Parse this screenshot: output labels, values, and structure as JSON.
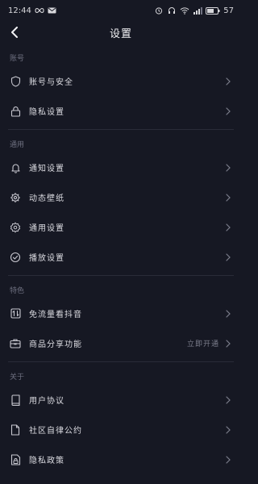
{
  "status_bar": {
    "time": "12:44",
    "battery": "57"
  },
  "nav": {
    "title": "设置"
  },
  "sections": [
    {
      "header": "账号",
      "items": [
        {
          "label": "账号与安全",
          "icon": "shield-icon"
        },
        {
          "label": "隐私设置",
          "icon": "lock-icon"
        }
      ]
    },
    {
      "header": "通用",
      "items": [
        {
          "label": "通知设置",
          "icon": "bell-icon"
        },
        {
          "label": "动态壁纸",
          "icon": "wallpaper-icon"
        },
        {
          "label": "通用设置",
          "icon": "gear-icon"
        },
        {
          "label": "播放设置",
          "icon": "play-icon"
        }
      ]
    },
    {
      "header": "特色",
      "items": [
        {
          "label": "免流量看抖音",
          "icon": "data-icon"
        },
        {
          "label": "商品分享功能",
          "icon": "briefcase-icon",
          "value": "立即开通"
        }
      ]
    },
    {
      "header": "关于",
      "items": [
        {
          "label": "用户协议",
          "icon": "book-icon"
        },
        {
          "label": "社区自律公约",
          "icon": "document-icon"
        },
        {
          "label": "隐私政策",
          "icon": "privacy-icon"
        }
      ]
    }
  ]
}
